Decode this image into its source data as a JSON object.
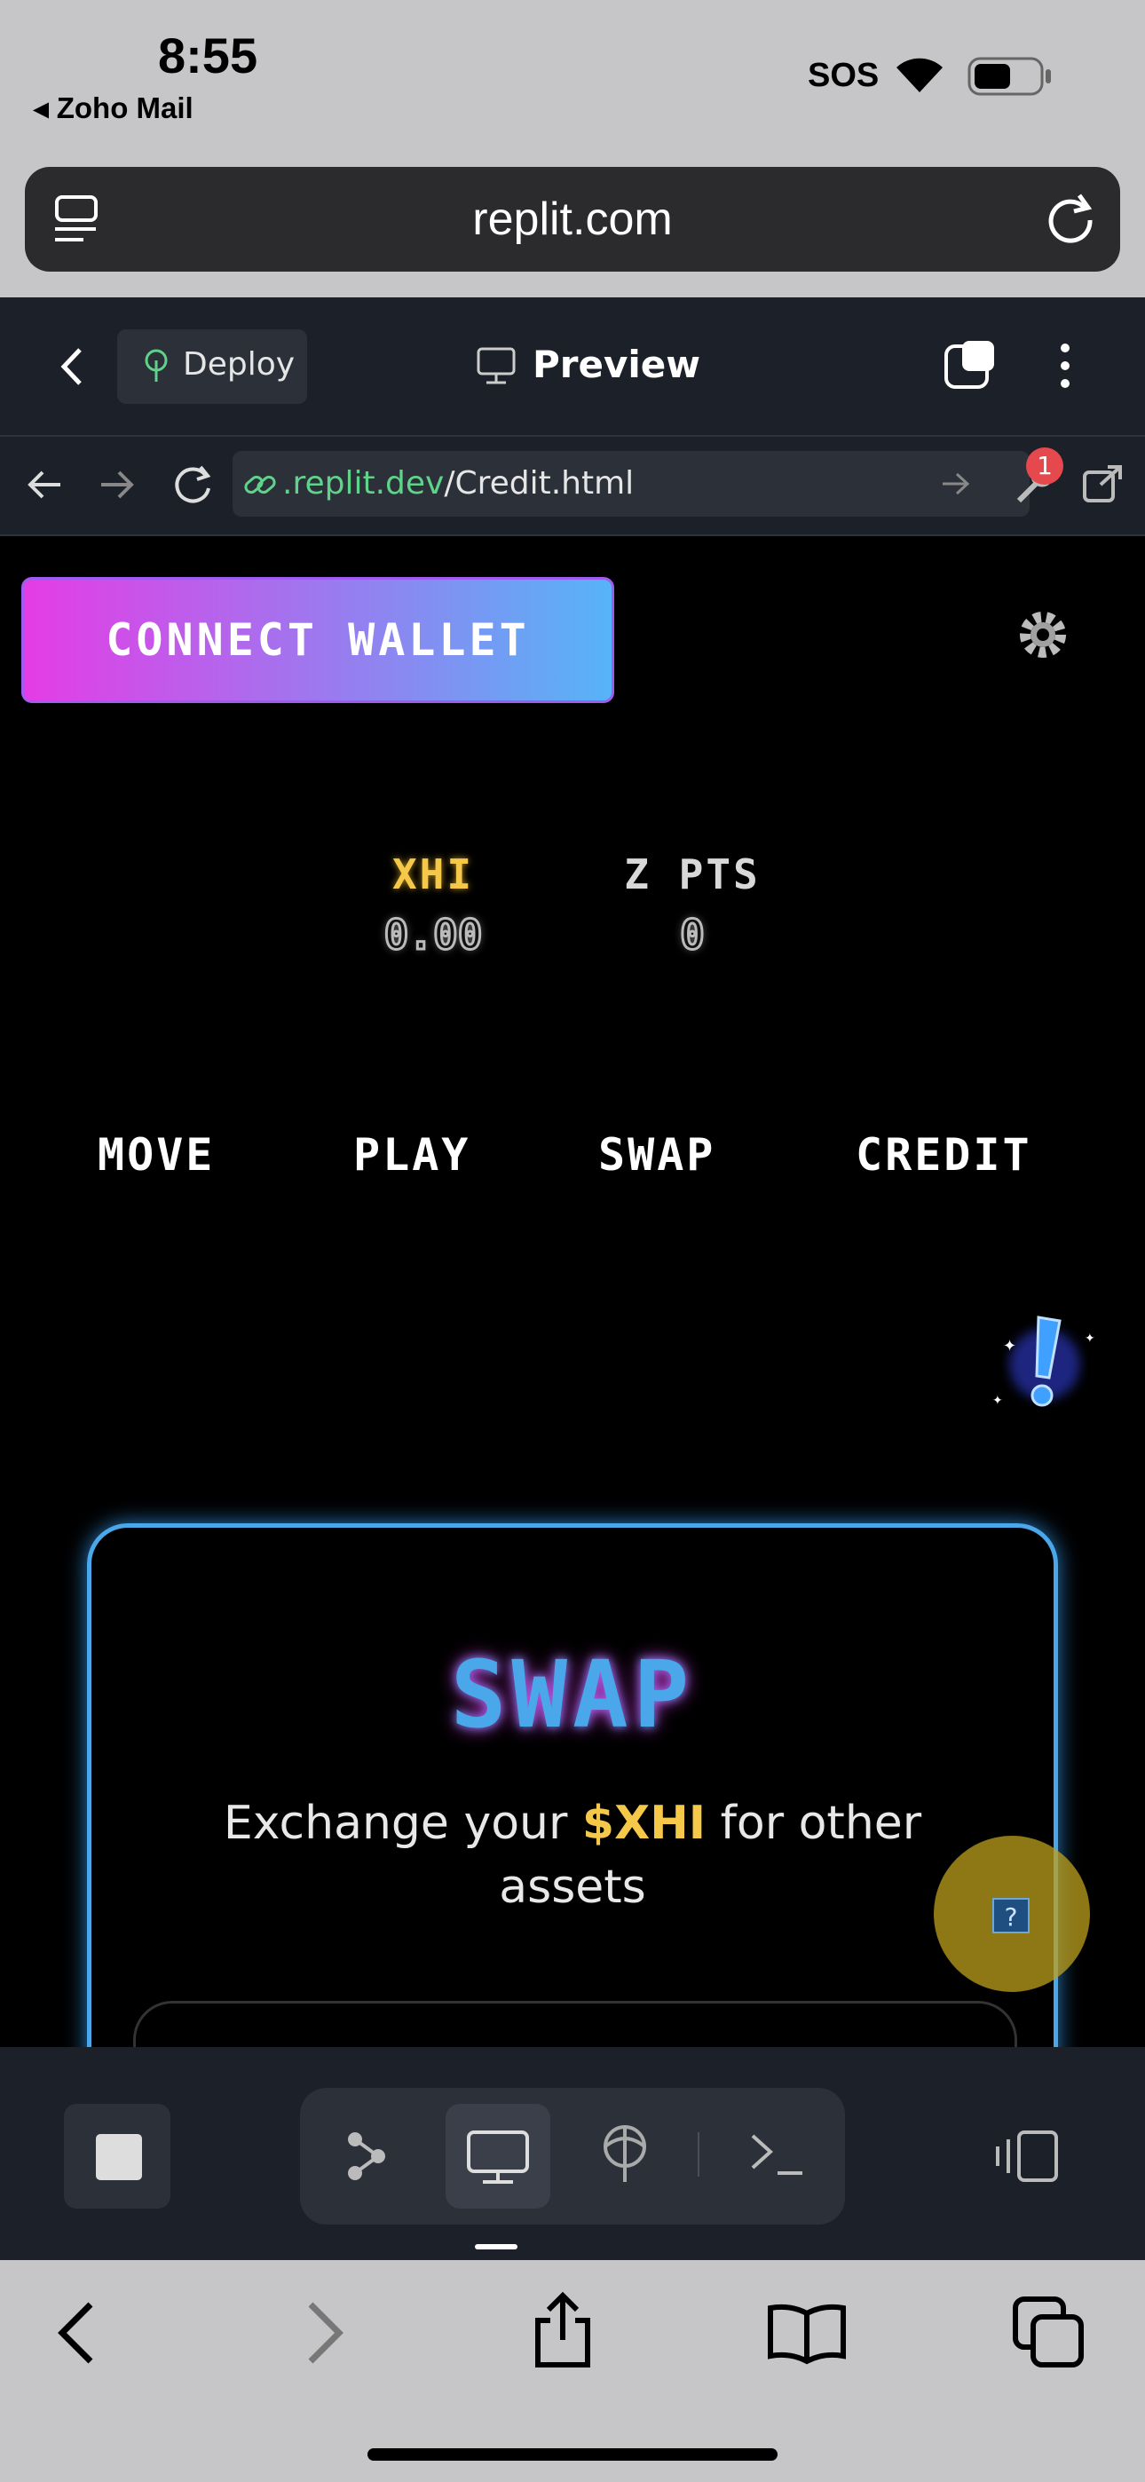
{
  "status_bar": {
    "time": "8:55",
    "back_app": "◂ Zoho Mail",
    "sos": "SOS"
  },
  "browser": {
    "url": "replit.com"
  },
  "replit": {
    "deploy_label": "Deploy",
    "preview_label": "Preview",
    "address_domain": ".replit.dev",
    "address_path": "/Credit.html",
    "notification_count": "1"
  },
  "app": {
    "connect_wallet": "CONNECT WALLET",
    "stats": [
      {
        "label": "XHI",
        "value": "0.00",
        "color": "#f5c84a"
      },
      {
        "label": "Z PTS",
        "value": "0",
        "color": "#d8d8d8"
      }
    ],
    "tabs": [
      "MOVE",
      "PLAY",
      "SWAP",
      "CREDIT"
    ],
    "swap": {
      "title": "SWAP",
      "sub_pre": "Exchange your ",
      "sub_highlight": "$XHI",
      "sub_post": " for other assets"
    },
    "help_label": "?"
  }
}
